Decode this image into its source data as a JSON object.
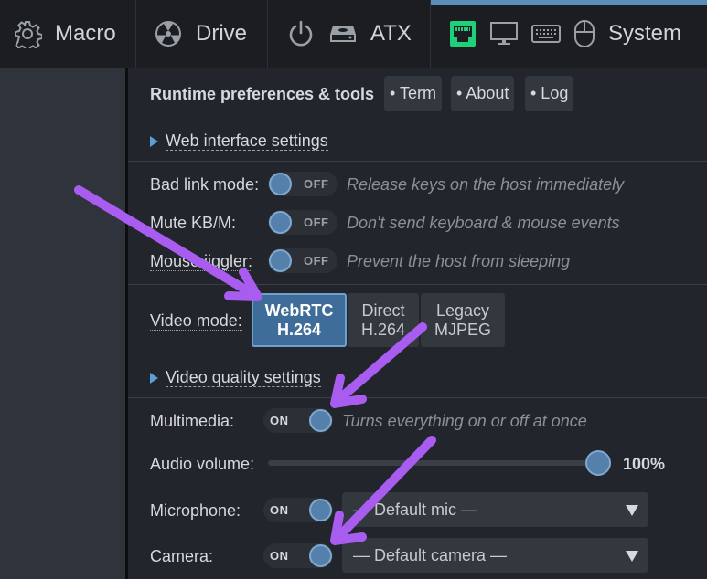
{
  "topbar": {
    "macro": {
      "label": "Macro",
      "icon": "gear-icon"
    },
    "drive": {
      "label": "Drive",
      "icon": "disc-icon"
    },
    "atx": {
      "label": "ATX",
      "icon": "power-icon"
    },
    "system": {
      "label": "System",
      "icons": [
        "ethernet-icon",
        "monitor-icon",
        "keyboard-icon",
        "mouse-icon"
      ]
    },
    "accent_color": "#5b8db8",
    "ethernet_status_color": "#1fd07a"
  },
  "menu": {
    "title": "Runtime preferences & tools",
    "tools": [
      "• Term",
      "• About",
      "• Log"
    ],
    "web_settings": "Web interface settings",
    "bad_link": {
      "label": "Bad link mode:",
      "state": "OFF",
      "hint": "Release keys on the host immediately"
    },
    "mute": {
      "label": "Mute KB/M:",
      "state": "OFF",
      "hint": "Don't send keyboard & mouse events"
    },
    "jiggler": {
      "label": "Mouse jiggler:",
      "state": "OFF",
      "hint": "Prevent the host from sleeping"
    },
    "video_mode": {
      "label": "Video mode:",
      "options": [
        {
          "line1": "WebRTC",
          "line2": "H.264",
          "active": true
        },
        {
          "line1": "Direct",
          "line2": "H.264",
          "active": false
        },
        {
          "line1": "Legacy",
          "line2": "MJPEG",
          "active": false
        }
      ]
    },
    "video_quality": "Video quality settings",
    "multimedia": {
      "label": "Multimedia:",
      "state": "ON",
      "hint": "Turns everything on or off at once"
    },
    "audio": {
      "label": "Audio volume:",
      "value": "100%",
      "level": 1.0
    },
    "microphone": {
      "label": "Microphone:",
      "state": "ON",
      "selected": "— Default mic —"
    },
    "camera": {
      "label": "Camera:",
      "state": "ON",
      "selected": "— Default camera —"
    }
  },
  "annotation_color": "#a95cf0"
}
